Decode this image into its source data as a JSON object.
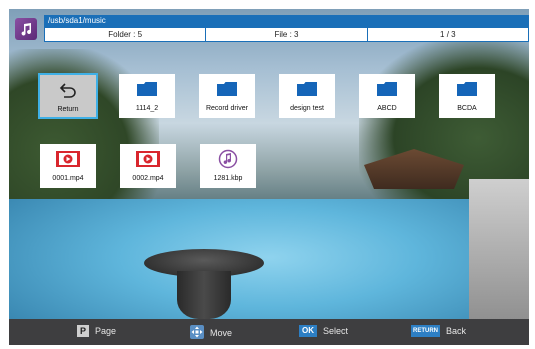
{
  "header": {
    "path": "/usb/sda1/music",
    "folder_count": "Folder : 5",
    "file_count": "File : 3",
    "page": "1 / 3"
  },
  "items": [
    {
      "label": "Return",
      "icon": "return-arrow-icon",
      "selected": true
    },
    {
      "label": "1114_2",
      "icon": "folder-icon"
    },
    {
      "label": "Record driver",
      "icon": "folder-icon"
    },
    {
      "label": "design test",
      "icon": "folder-icon"
    },
    {
      "label": "ABCD",
      "icon": "folder-icon"
    },
    {
      "label": "BCDA",
      "icon": "folder-icon"
    },
    {
      "label": "0001.mp4",
      "icon": "video-file-icon"
    },
    {
      "label": "0002.mp4",
      "icon": "video-file-icon"
    },
    {
      "label": "1281.kbp",
      "icon": "music-file-icon"
    }
  ],
  "footer": {
    "page_key": "P",
    "page_label": "Page",
    "move_label": "Move",
    "select_key": "OK",
    "select_label": "Select",
    "back_key": "RETURN",
    "back_label": "Back"
  },
  "colors": {
    "accent_blue": "#1a6fb8",
    "selection_border": "#3fb0e6",
    "video_red": "#d9262d",
    "music_purple": "#8a4fa3",
    "footer_bg": "#3e3e40"
  }
}
